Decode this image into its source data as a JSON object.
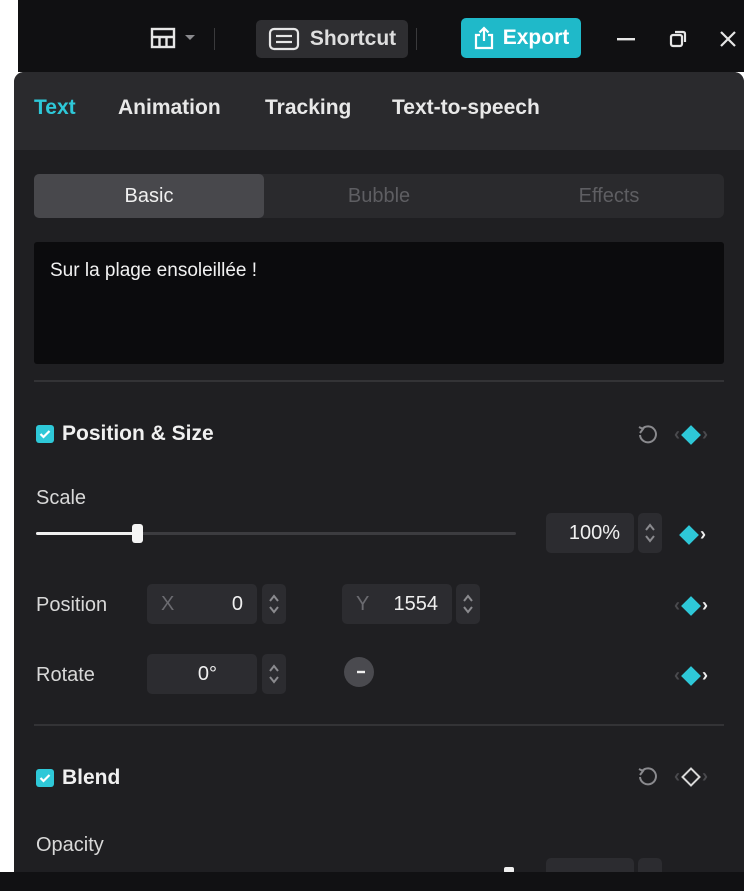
{
  "titlebar": {
    "shortcut_label": "Shortcut",
    "export_label": "Export",
    "accent": "#1fb9c9"
  },
  "tabs": [
    {
      "label": "Text",
      "active": true
    },
    {
      "label": "Animation",
      "active": false
    },
    {
      "label": "Tracking",
      "active": false
    },
    {
      "label": "Text-to-speech",
      "active": false
    }
  ],
  "segments": [
    {
      "label": "Basic",
      "active": true
    },
    {
      "label": "Bubble",
      "active": false
    },
    {
      "label": "Effects",
      "active": false
    }
  ],
  "text_content": "Sur la plage ensoleillée !",
  "position_size": {
    "title": "Position & Size",
    "enabled": true,
    "scale_label": "Scale",
    "scale_value": "100%",
    "scale_fraction": 0.21,
    "position_label": "Position",
    "x_prefix": "X",
    "x_value": "0",
    "y_prefix": "Y",
    "y_value": "1554",
    "rotate_label": "Rotate",
    "rotate_value": "0°"
  },
  "blend": {
    "title": "Blend",
    "enabled": true,
    "opacity_label": "Opacity"
  },
  "icons": [
    "layout-icon",
    "chevron-down-icon",
    "keyboard-icon",
    "export-icon",
    "minimize-icon",
    "restore-icon",
    "close-icon",
    "reset-icon",
    "keyframe-diamond-icon",
    "chevron-right-icon",
    "check-icon",
    "rotate-dial-icon"
  ]
}
